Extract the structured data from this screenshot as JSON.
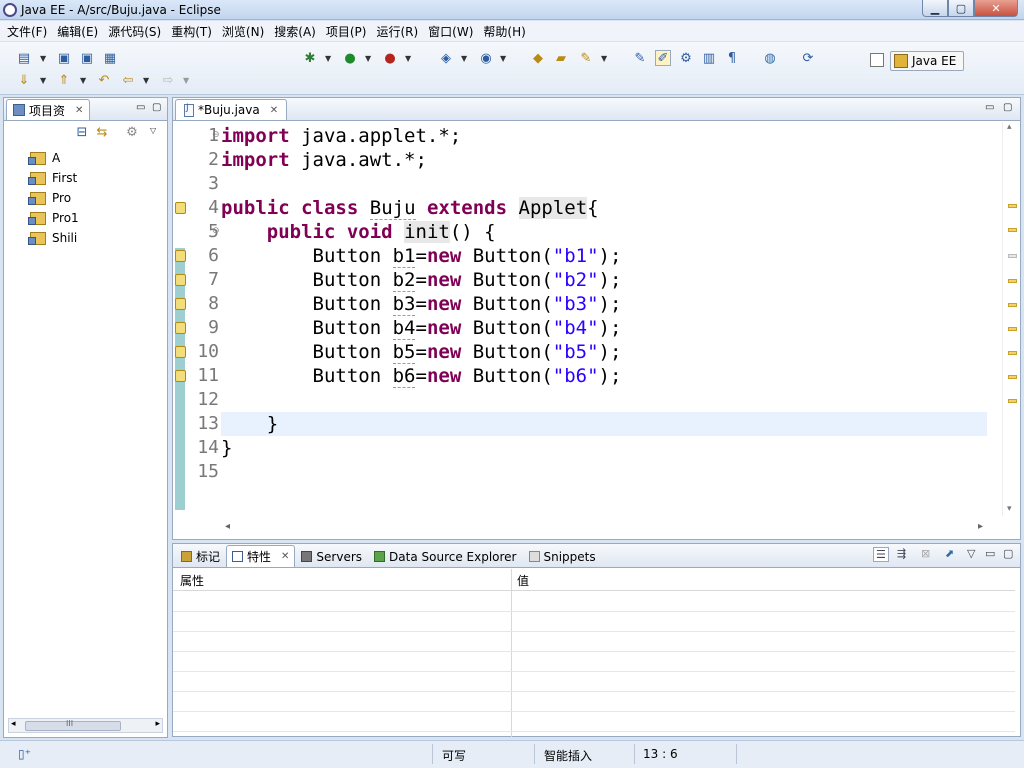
{
  "window": {
    "title": "Java EE  -  A/src/Buju.java  -  Eclipse",
    "min": "▁",
    "max": "▢",
    "close": "✕"
  },
  "menubar": [
    "文件(F)",
    "编辑(E)",
    "源代码(S)",
    "重构(T)",
    "浏览(N)",
    "搜索(A)",
    "项目(P)",
    "运行(R)",
    "窗口(W)",
    "帮助(H)"
  ],
  "toolbar": {
    "perspective_label": "Java EE"
  },
  "project_explorer": {
    "tab_label": "项目资",
    "close": "✕",
    "min": "▭",
    "max": "▢",
    "projects": [
      "A",
      "First",
      "Pro",
      "Pro1",
      "Shili"
    ],
    "scroll_grip": "III"
  },
  "editor": {
    "tab_label": "*Buju.java",
    "close": "✕",
    "line_numbers": [
      "1",
      "2",
      "3",
      "4",
      "5",
      "6",
      "7",
      "8",
      "9",
      "10",
      "11",
      "12",
      "13",
      "14",
      "15"
    ],
    "current_line": 13,
    "lines": [
      [
        {
          "t": "import",
          "c": "kw"
        },
        {
          "t": " java.applet.*;"
        }
      ],
      [
        {
          "t": "import",
          "c": "kw"
        },
        {
          "t": " java.awt.*;"
        }
      ],
      [],
      [
        {
          "t": "public",
          "c": "kw"
        },
        {
          "t": " "
        },
        {
          "t": "class",
          "c": "kw"
        },
        {
          "t": " "
        },
        {
          "t": "Buju",
          "c": "warn-u"
        },
        {
          "t": " "
        },
        {
          "t": "extends",
          "c": "kw"
        },
        {
          "t": " "
        },
        {
          "t": "Applet",
          "c": "hl"
        },
        {
          "t": "{"
        }
      ],
      [
        {
          "t": "    "
        },
        {
          "t": "public",
          "c": "kw"
        },
        {
          "t": " "
        },
        {
          "t": "void",
          "c": "kw"
        },
        {
          "t": " "
        },
        {
          "t": "init",
          "c": "hl"
        },
        {
          "t": "() {"
        }
      ],
      [
        {
          "t": "        Button "
        },
        {
          "t": "b1",
          "c": "warn-u"
        },
        {
          "t": "="
        },
        {
          "t": "new",
          "c": "kw"
        },
        {
          "t": " Button("
        },
        {
          "t": "\"b1\"",
          "c": "str"
        },
        {
          "t": ");"
        }
      ],
      [
        {
          "t": "        Button "
        },
        {
          "t": "b2",
          "c": "warn-u"
        },
        {
          "t": "="
        },
        {
          "t": "new",
          "c": "kw"
        },
        {
          "t": " Button("
        },
        {
          "t": "\"b2\"",
          "c": "str"
        },
        {
          "t": ");"
        }
      ],
      [
        {
          "t": "        Button "
        },
        {
          "t": "b3",
          "c": "warn-u"
        },
        {
          "t": "="
        },
        {
          "t": "new",
          "c": "kw"
        },
        {
          "t": " Button("
        },
        {
          "t": "\"b3\"",
          "c": "str"
        },
        {
          "t": ");"
        }
      ],
      [
        {
          "t": "        Button "
        },
        {
          "t": "b4",
          "c": "warn-u"
        },
        {
          "t": "="
        },
        {
          "t": "new",
          "c": "kw"
        },
        {
          "t": " Button("
        },
        {
          "t": "\"b4\"",
          "c": "str"
        },
        {
          "t": ");"
        }
      ],
      [
        {
          "t": "        Button "
        },
        {
          "t": "b5",
          "c": "warn-u"
        },
        {
          "t": "="
        },
        {
          "t": "new",
          "c": "kw"
        },
        {
          "t": " Button("
        },
        {
          "t": "\"b5\"",
          "c": "str"
        },
        {
          "t": ");"
        }
      ],
      [
        {
          "t": "        Button "
        },
        {
          "t": "b6",
          "c": "warn-u"
        },
        {
          "t": "="
        },
        {
          "t": "new",
          "c": "kw"
        },
        {
          "t": " Button("
        },
        {
          "t": "\"b6\"",
          "c": "str"
        },
        {
          "t": ");"
        }
      ],
      [],
      [
        {
          "t": "    }"
        }
      ],
      [
        {
          "t": "}"
        }
      ],
      []
    ],
    "scroll_left": "◂",
    "scroll_right": "▸",
    "scroll_down": "▾",
    "scroll_up": "▴"
  },
  "bottom_panel": {
    "tabs": [
      {
        "label": "标记",
        "active": false,
        "close": ""
      },
      {
        "label": "特性",
        "active": true,
        "close": "✕"
      },
      {
        "label": "Servers",
        "active": false,
        "close": ""
      },
      {
        "label": "Data Source Explorer",
        "active": false,
        "close": ""
      },
      {
        "label": "Snippets",
        "active": false,
        "close": ""
      }
    ],
    "col_property": "属性",
    "col_value": "值"
  },
  "statusbar": {
    "writable": "可写",
    "insert_mode": "智能插入",
    "position": "13 : 6"
  }
}
